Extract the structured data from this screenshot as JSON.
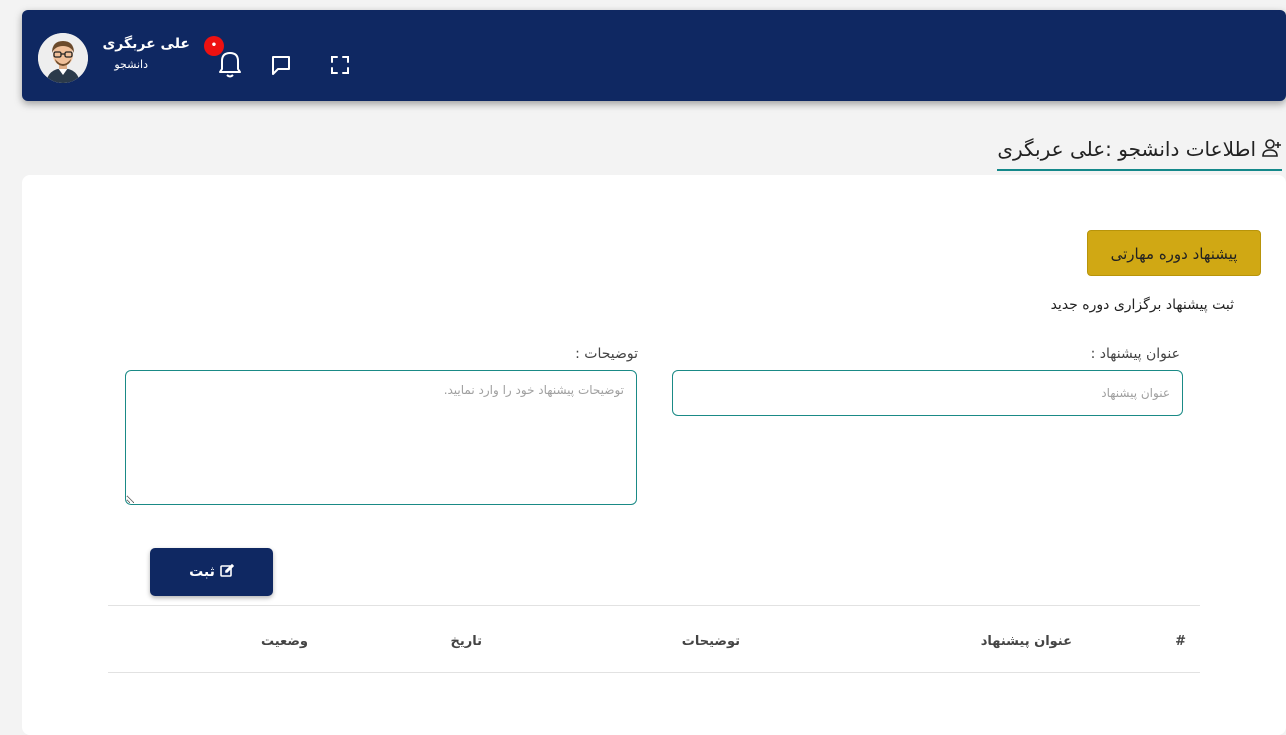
{
  "header": {
    "user_name": "علی عربگری",
    "user_role": "دانشجو",
    "notification_count": "•",
    "icons": [
      "avatar",
      "bell-icon",
      "chat-icon",
      "fullscreen-icon"
    ]
  },
  "page": {
    "title": "اطلاعات دانشجو :علی عربگری",
    "title_icon": "user-plus-icon"
  },
  "form": {
    "suggest_button_label": "پیشنهاد دوره مهارتی",
    "section_title": "ثبت پیشنهاد برگزاری دوره جدید",
    "title_label": "عنوان پیشنهاد :",
    "title_placeholder": "عنوان پیشنهاد",
    "title_value": "",
    "desc_label": "توضیحات :",
    "desc_placeholder": "توضیحات پیشنهاد خود را وارد نمایید.",
    "desc_value": "",
    "submit_label": "ثبت",
    "submit_icon": "edit-icon"
  },
  "table": {
    "headers": [
      "#",
      "عنوان پیشنهاد",
      "توضیحات",
      "تاریخ",
      "وضعیت"
    ],
    "rows": []
  },
  "colors": {
    "primary": "#0f2862",
    "accent": "#d0a814",
    "input_border": "#1a8a86",
    "badge": "#ee1111"
  }
}
